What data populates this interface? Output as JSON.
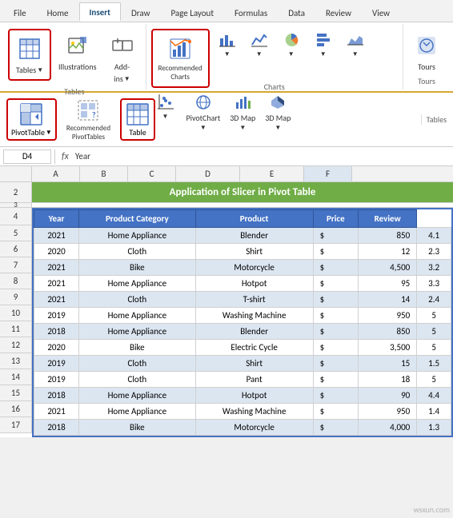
{
  "ribbon": {
    "tabs": [
      "File",
      "Home",
      "Insert",
      "Draw",
      "Page Layout",
      "Formulas",
      "Data",
      "Review",
      "View"
    ],
    "active_tab": "Insert",
    "groups": {
      "tables": {
        "label": "Tables",
        "buttons": [
          {
            "id": "tables",
            "label": "Tables",
            "highlighted": true
          },
          {
            "id": "illustrations",
            "label": "Illustrations"
          },
          {
            "id": "add_ins",
            "label": "Add-ins"
          }
        ]
      },
      "charts": {
        "label": "Charts",
        "buttons": [
          {
            "id": "recommended_charts",
            "label": "Recommended\nCharts",
            "highlighted": true
          },
          {
            "id": "column_chart",
            "label": ""
          },
          {
            "id": "line_chart",
            "label": ""
          },
          {
            "id": "pie_chart",
            "label": ""
          },
          {
            "id": "bar_chart",
            "label": ""
          },
          {
            "id": "area_chart",
            "label": ""
          },
          {
            "id": "scatter",
            "label": ""
          },
          {
            "id": "maps",
            "label": "Maps"
          },
          {
            "id": "pivot_chart",
            "label": "PivotChart"
          },
          {
            "id": "3d_map",
            "label": "3D Map"
          }
        ]
      },
      "tours": {
        "label": "Tours"
      }
    },
    "sub_buttons": [
      {
        "id": "pivot_table",
        "label": "PivotTable",
        "highlighted": true
      },
      {
        "id": "recommended_pivot",
        "label": "Recommended\nPivotTables"
      },
      {
        "id": "table",
        "label": "Table",
        "highlighted": true
      }
    ],
    "sub_group_label": "Tables"
  },
  "formula_bar": {
    "name_box": "D4",
    "fx": "fx",
    "value": "Year"
  },
  "col_headers": [
    "D",
    "E",
    "F"
  ],
  "spreadsheet": {
    "title": "Application of Slicer in Pivot Table",
    "row_numbers": [
      2,
      3,
      4,
      5,
      6,
      7,
      8,
      9,
      10,
      11,
      12,
      13,
      14,
      15,
      16,
      17
    ],
    "table_headers": [
      "Year",
      "Product Category",
      "Product",
      "Price",
      "Review"
    ],
    "rows": [
      {
        "year": "2021",
        "category": "Home Appliance",
        "product": "Blender",
        "price_sym": "$",
        "price_val": "850",
        "review": "4.1"
      },
      {
        "year": "2020",
        "category": "Cloth",
        "product": "Shirt",
        "price_sym": "$",
        "price_val": "12",
        "review": "2.3"
      },
      {
        "year": "2021",
        "category": "Bike",
        "product": "Motorcycle",
        "price_sym": "$",
        "price_val": "4,500",
        "review": "3.2"
      },
      {
        "year": "2021",
        "category": "Home Appliance",
        "product": "Hotpot",
        "price_sym": "$",
        "price_val": "95",
        "review": "3.3"
      },
      {
        "year": "2021",
        "category": "Cloth",
        "product": "T-shirt",
        "price_sym": "$",
        "price_val": "14",
        "review": "2.4"
      },
      {
        "year": "2019",
        "category": "Home Appliance",
        "product": "Washing Machine",
        "price_sym": "$",
        "price_val": "950",
        "review": "5"
      },
      {
        "year": "2018",
        "category": "Home Appliance",
        "product": "Blender",
        "price_sym": "$",
        "price_val": "850",
        "review": "5"
      },
      {
        "year": "2020",
        "category": "Bike",
        "product": "Electric Cycle",
        "price_sym": "$",
        "price_val": "3,500",
        "review": "5"
      },
      {
        "year": "2019",
        "category": "Cloth",
        "product": "Shirt",
        "price_sym": "$",
        "price_val": "15",
        "review": "1.5"
      },
      {
        "year": "2019",
        "category": "Cloth",
        "product": "Pant",
        "price_sym": "$",
        "price_val": "18",
        "review": "5"
      },
      {
        "year": "2018",
        "category": "Home Appliance",
        "product": "Hotpot",
        "price_sym": "$",
        "price_val": "90",
        "review": "4.4"
      },
      {
        "year": "2021",
        "category": "Home Appliance",
        "product": "Washing Machine",
        "price_sym": "$",
        "price_val": "950",
        "review": "1.4"
      },
      {
        "year": "2018",
        "category": "Bike",
        "product": "Motorcycle",
        "price_sym": "$",
        "price_val": "4,000",
        "review": "1.3"
      }
    ]
  },
  "watermark": "wsxun.com"
}
